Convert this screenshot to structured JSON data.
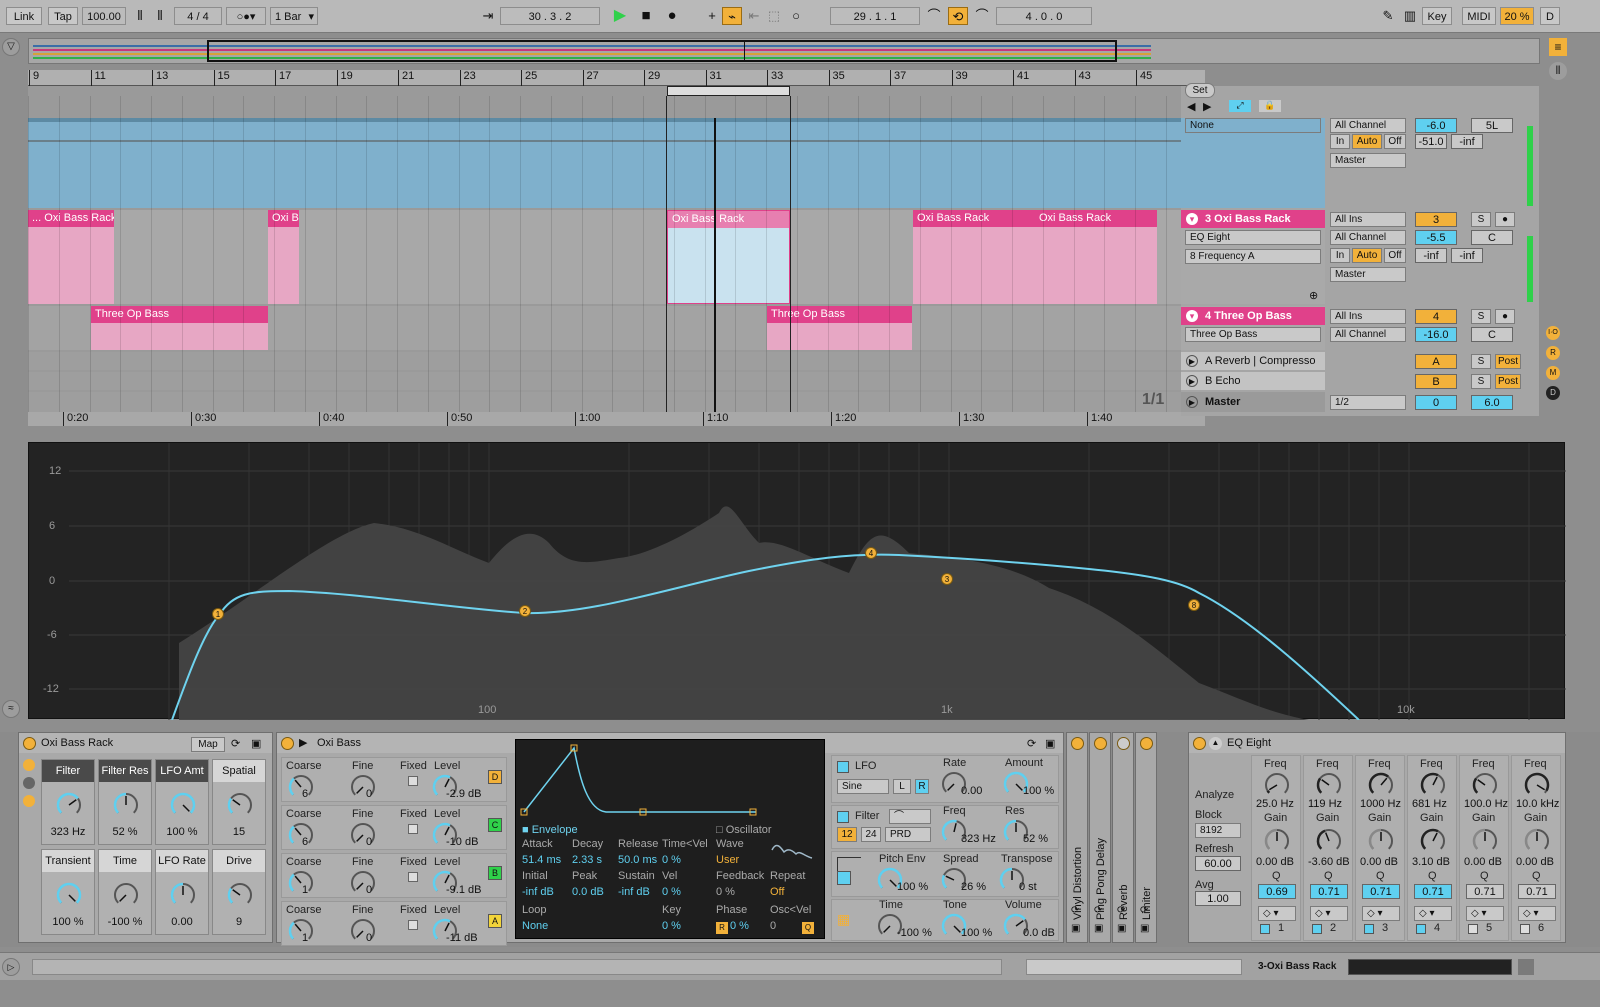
{
  "transport": {
    "link": "Link",
    "tap": "Tap",
    "tempo": "100.00",
    "signature": "4 / 4",
    "quantize": "1 Bar",
    "position": "30 .  3 .  2",
    "loop_start": "29 .  1 .  1",
    "loop_length": "4 .  0 .  0",
    "key": "Key",
    "midi": "MIDI",
    "cpu": "20 %",
    "d": "D"
  },
  "ruler": {
    "bars": [
      "9",
      "11",
      "13",
      "15",
      "17",
      "19",
      "21",
      "23",
      "25",
      "27",
      "29",
      "31",
      "33",
      "35",
      "37",
      "39",
      "41",
      "43",
      "45"
    ],
    "times": [
      "0:20",
      "0:30",
      "0:40",
      "0:50",
      "1:00",
      "1:10",
      "1:20",
      "1:30",
      "1:40"
    ],
    "page": "1/1"
  },
  "clips": {
    "oxi_bass_rack": "Oxi Bass Rack",
    "oxi_bass_rack_trunc1": "... Oxi Bass Rack",
    "oxi_bass_rack_trunc2": "Oxi Ba",
    "three_op_bass": "Three Op Bass"
  },
  "mixer": {
    "set_label": "Set",
    "row1": {
      "in_sel": "None",
      "channel": "All Channel",
      "in": "In",
      "auto": "Auto",
      "off": "Off",
      "out": "Master",
      "vol": "-6.0",
      "pan": "5L",
      "peak": "-51.0",
      "peak2": "-inf"
    },
    "track3": {
      "name": "3 Oxi Bass Rack",
      "input": "All Ins",
      "channel": "All Channel",
      "device": "EQ Eight",
      "param": "8 Frequency A",
      "in": "In",
      "auto": "Auto",
      "off": "Off",
      "out": "Master",
      "num": "3",
      "s": "S",
      "vol": "-5.5",
      "pan": "C",
      "peak": "-inf",
      "peak2": "-inf"
    },
    "track4": {
      "name": "4 Three Op Bass",
      "input": "All Ins",
      "channel": "All Channel",
      "device": "Three Op Bass",
      "num": "4",
      "s": "S",
      "vol": "-16.0",
      "pan": "C"
    },
    "return_a": {
      "name": "A Reverb | Compresso",
      "num": "A",
      "s": "S",
      "post": "Post"
    },
    "return_b": {
      "name": "B Echo",
      "num": "B",
      "s": "S",
      "post": "Post"
    },
    "master": {
      "name": "Master",
      "cue": "1/2",
      "num": "0",
      "vol": "6.0"
    },
    "side_letters": [
      "I·O",
      "R",
      "M",
      "D"
    ]
  },
  "eq_display": {
    "y_ticks": [
      "12",
      "6",
      "0",
      "-6",
      "-12"
    ],
    "x_ticks": [
      "100",
      "1k",
      "10k"
    ],
    "bands": [
      "1",
      "2",
      "4",
      "3",
      "8"
    ]
  },
  "rack": {
    "title": "Oxi Bass Rack",
    "map": "Map",
    "macros": [
      {
        "name": "Filter",
        "value": "323 Hz"
      },
      {
        "name": "Filter Res",
        "value": "52 %"
      },
      {
        "name": "LFO Amt",
        "value": "100 %"
      },
      {
        "name": "Spatial",
        "value": "15"
      },
      {
        "name": "Transient",
        "value": "100 %"
      },
      {
        "name": "Time",
        "value": "-100 %"
      },
      {
        "name": "LFO Rate",
        "value": "0.00"
      },
      {
        "name": "Drive",
        "value": "9"
      }
    ]
  },
  "oxi": {
    "title": "Oxi Bass",
    "ops": [
      {
        "coarse": "6",
        "fine": "0",
        "level": "-2.9 dB",
        "tag": "D"
      },
      {
        "coarse": "6",
        "fine": "0",
        "level": "-10 dB",
        "tag": "C"
      },
      {
        "coarse": "1",
        "fine": "0",
        "level": "-9.1 dB",
        "tag": "B"
      },
      {
        "coarse": "1",
        "fine": "0",
        "level": "-11 dB",
        "tag": "A"
      }
    ],
    "labels": {
      "coarse": "Coarse",
      "fine": "Fine",
      "fixed": "Fixed",
      "level": "Level"
    },
    "env_tab": "Envelope",
    "osc_tab": "Oscillator",
    "env": {
      "attack_l": "Attack",
      "attack": "51.4 ms",
      "decay_l": "Decay",
      "decay": "2.33 s",
      "release_l": "Release",
      "release": "50.0 ms",
      "timevel_l": "Time<Vel",
      "timevel": "0 %",
      "wave_l": "Wave",
      "wave": "User",
      "initial_l": "Initial",
      "initial": "-inf dB",
      "peak_l": "Peak",
      "peak": "0.0 dB",
      "sustain_l": "Sustain",
      "sustain": "-inf dB",
      "vel_l": "Vel",
      "vel": "0 %",
      "feedback_l": "Feedback",
      "feedback": "0 %",
      "repeat_l": "Repeat",
      "repeat": "Off",
      "loop_l": "Loop",
      "loop": "None",
      "key_l": "Key",
      "key": "0 %",
      "phase_l": "Phase",
      "phase": "0 %",
      "phase_tag": "R",
      "oscvel_l": "Osc<Vel",
      "oscvel": "0",
      "oscvel_tag": "Q"
    },
    "lfo": {
      "label": "LFO",
      "wave": "Sine",
      "l": "L",
      "r": "R",
      "rate_l": "Rate",
      "rate": "0.00",
      "amount_l": "Amount",
      "amount": "100 %"
    },
    "filter": {
      "label": "Filter",
      "freq_l": "Freq",
      "freq": "323 Hz",
      "res_l": "Res",
      "res": "52 %",
      "b12": "12",
      "b24": "24",
      "prd": "PRD"
    },
    "pitch": {
      "pitchenv_l": "Pitch Env",
      "pitchenv": "100 %",
      "spread_l": "Spread",
      "spread": "26 %",
      "transpose_l": "Transpose",
      "transpose": "0 st"
    },
    "global": {
      "time_l": "Time",
      "time": "-100 %",
      "tone_l": "Tone",
      "tone": "100 %",
      "volume_l": "Volume",
      "volume": "0.0 dB"
    }
  },
  "fx_chain": [
    "Vinyl Distortion",
    "Ping Pong Delay",
    "Reverb",
    "Limiter"
  ],
  "eq8": {
    "title": "EQ Eight",
    "analyze": "Analyze",
    "block_l": "Block",
    "block": "8192",
    "refresh_l": "Refresh",
    "refresh": "60.00",
    "avg_l": "Avg",
    "avg": "1.00",
    "bands": [
      {
        "freq": "25.0 Hz",
        "gain": "0.00 dB",
        "q": "0.69",
        "n": "1"
      },
      {
        "freq": "119 Hz",
        "gain": "-3.60 dB",
        "q": "0.71",
        "n": "2"
      },
      {
        "freq": "1000 Hz",
        "gain": "0.00 dB",
        "q": "0.71",
        "n": "3"
      },
      {
        "freq": "681 Hz",
        "gain": "3.10 dB",
        "q": "0.71",
        "n": "4"
      },
      {
        "freq": "100.0 Hz",
        "gain": "0.00 dB",
        "q": "0.71",
        "n": "5"
      },
      {
        "freq": "10.0 kHz",
        "gain": "0.00 dB",
        "q": "0.71",
        "n": "6"
      }
    ],
    "labels": {
      "freq": "Freq",
      "gain": "Gain",
      "q": "Q"
    }
  },
  "status": {
    "track": "3-Oxi Bass Rack"
  },
  "colors": {
    "accent_orange": "#f2b13a",
    "clip_pink": "#e0418a",
    "clip_blue": "#7fb0cc",
    "cyan": "#5fd0f0",
    "green": "#2fd14a"
  }
}
